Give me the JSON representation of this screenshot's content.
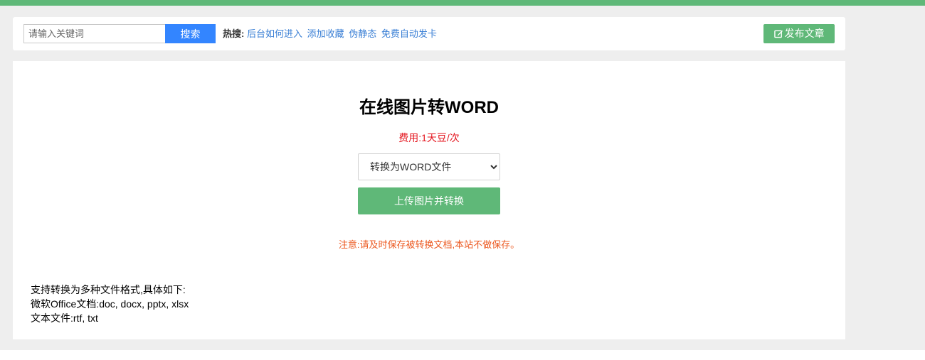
{
  "header": {
    "search_placeholder": "请输入关键词",
    "search_button": "搜索",
    "hot_label": "热搜:",
    "hot_links": [
      "后台如何进入",
      "添加收藏",
      "伪静态",
      "免费自动发卡"
    ],
    "publish_button": "发布文章",
    "publish_icon": "edit-icon"
  },
  "main": {
    "title": "在线图片转WORD",
    "fee": "费用:1天豆/次",
    "select_value": "转换为WORD文件",
    "upload_button": "上传图片并转换",
    "notice": "注意:请及时保存被转换文档,本站不做保存。",
    "support_lines": [
      "支持转换为多种文件格式,具体如下:",
      "微软Office文档:doc, docx, pptx, xlsx",
      "文本文件:rtf, txt"
    ]
  },
  "colors": {
    "accent_green": "#5fb878",
    "search_blue": "#3385ff",
    "link_blue": "#3a7fd5",
    "fee_red": "#e4161f",
    "notice_orange": "#ec5a22",
    "background_gray": "#eeeeee"
  }
}
